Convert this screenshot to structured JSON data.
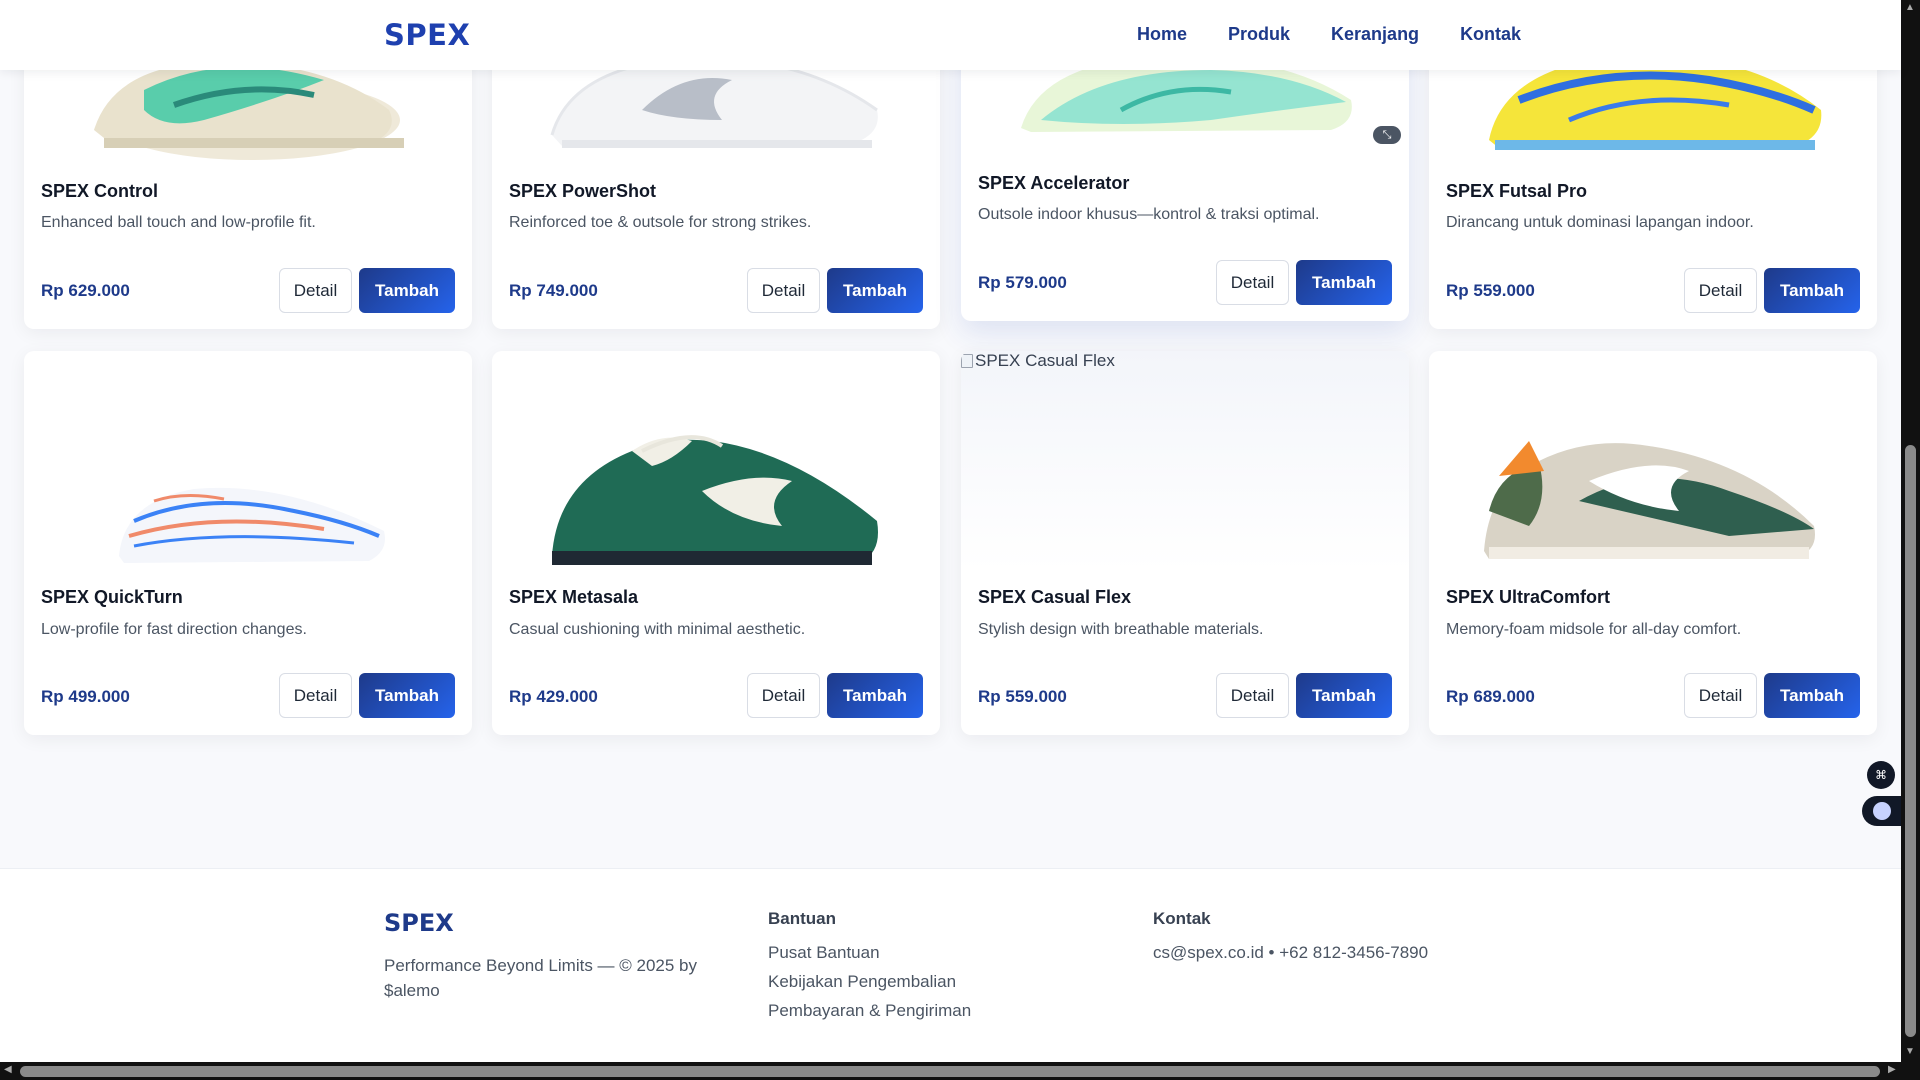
{
  "header": {
    "brand": "SPEX",
    "nav": [
      "Home",
      "Produk",
      "Keranjang",
      "Kontak"
    ]
  },
  "products": [
    {
      "name": "SPEX Control",
      "desc": "Enhanced ball touch and low-profile fit.",
      "price": "Rp 629.000"
    },
    {
      "name": "SPEX PowerShot",
      "desc": "Reinforced toe & outsole for strong strikes.",
      "price": "Rp 749.000"
    },
    {
      "name": "SPEX Accelerator",
      "desc": "Outsole indoor khusus—kontrol & traksi optimal.",
      "price": "Rp 579.000"
    },
    {
      "name": "SPEX Futsal Pro",
      "desc": "Dirancang untuk dominasi lapangan indoor.",
      "price": "Rp 559.000"
    },
    {
      "name": "SPEX QuickTurn",
      "desc": "Low-profile for fast direction changes.",
      "price": "Rp 499.000"
    },
    {
      "name": "SPEX Metasala",
      "desc": "Casual cushioning with minimal aesthetic.",
      "price": "Rp 429.000"
    },
    {
      "name": "SPEX Casual Flex",
      "desc": "Stylish design with breathable materials.",
      "price": "Rp 559.000",
      "img_alt": "SPEX Casual Flex"
    },
    {
      "name": "SPEX UltraComfort",
      "desc": "Memory-foam midsole for all-day comfort.",
      "price": "Rp 689.000"
    }
  ],
  "buttons": {
    "detail": "Detail",
    "add": "Tambah"
  },
  "footer": {
    "brand": "SPEX",
    "tagline": "Performance Beyond Limits — © 2025 by $alemo",
    "help_heading": "Bantuan",
    "help_links": [
      "Pusat Bantuan",
      "Kebijakan Pengembalian",
      "Pembayaran & Pengiriman"
    ],
    "contact_heading": "Kontak",
    "contact": "cs@spex.co.id • +62 812-3456-7890"
  },
  "colors": {
    "brand": "#1e40af",
    "price": "#1e3a8a",
    "button_gradient": [
      "#1e3a8a",
      "#2563eb"
    ]
  }
}
